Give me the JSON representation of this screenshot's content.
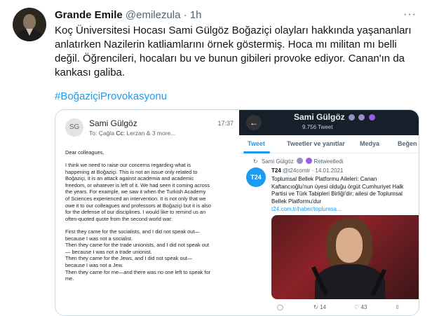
{
  "tweet": {
    "author_name": "Grande Emile",
    "handle": "@emilezula",
    "separator": "·",
    "time": "1h",
    "more": "···",
    "text": "Koç Üniversitesi Hocası Sami Gülgöz Boğaziçi olayları hakkında yaşananları anlatırken Nazilerin katliamlarını örnek göstermiş. Hoca mı militan mı belli değil. Öğrencileri, hocaları bu ve bunun gibileri provoke ediyor. Canan'ın da kankası galiba.",
    "hashtag": "#BoğaziçiProvokasyonu"
  },
  "email": {
    "avatar_initials": "SG",
    "sender": "Sami Gülgöz",
    "to_label": "To:",
    "to_value": "Çağla",
    "cc_label": "Cc:",
    "cc_value": "Lerzan & 3 more...",
    "time": "17:37",
    "greeting": "Dear colleagues,",
    "para1": [
      "I think we need to raise our concerns regarding what is",
      "happening at Boğaziçi. This is not an issue only related to",
      "Boğaziçi, it is an attack against academia and academic",
      "freedom, or whatever is left of it. We had seen it coming across",
      "the years. For example, we saw it when the Turkish Academy",
      "of Sciences experienced an intervention. It is not only that we",
      "owe it to our colleagues and professors at Boğaziçi but it is also",
      "for the defense of our disciplines. I would like to remind us an",
      "often-quoted quote from the second world war:"
    ],
    "para2": [
      "First they came for the socialists, and I did not speak out—",
      "because I was not a socialist.",
      "Then they came for the trade unionists, and I did not speak out",
      "— because I was not a trade unionist.",
      "Then they came for the Jews, and I did not speak out—",
      "because I was not a Jew.",
      "Then they came for me—and there was no one left to speak for",
      "me."
    ]
  },
  "profile": {
    "back_icon": "back-arrow-icon",
    "name": "Sami Gülgöz",
    "tweet_count": "9.756 Tweet",
    "tabs": [
      "Tweet",
      "Tweetler ve yanıtlar",
      "Medya",
      "Beğen"
    ],
    "retweet_label": "Sami Gülgöz",
    "retweet_suffix": "Retweetledi",
    "inner_avatar": "T24",
    "inner_name": "T24",
    "inner_handle": "@t24comtr · 14.01.2021",
    "inner_text": "Toplumsal Bellek Platformu Aileleri: Canan Kaftancıoğlu'nun üyesi olduğu örgüt Cumhuriyet Halk Partisi ve Türk Tabipleri Birliği'dir; ailesi de Toplumsal Bellek Platformu'dur",
    "inner_link": "t24.com.tr/haber/toplumsa...",
    "actions": {
      "reply": "",
      "retweets": "14",
      "likes": "43"
    }
  },
  "colors": {
    "accent": "#1d9bf0",
    "dark_header": "#15202b",
    "secondary_text": "#536471"
  }
}
